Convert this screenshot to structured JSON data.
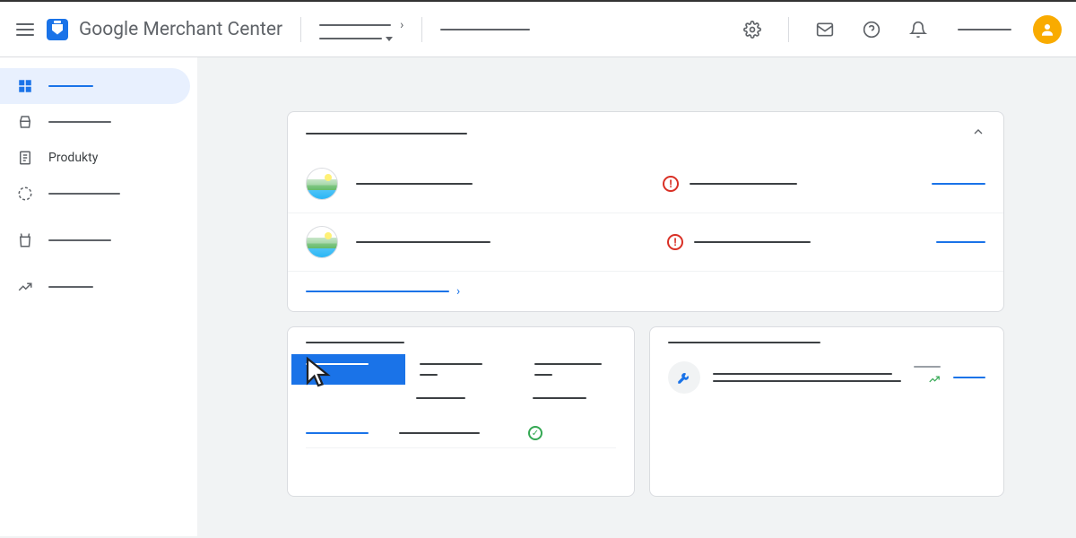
{
  "header": {
    "app_title": "Google Merchant Center",
    "account_selector": "",
    "search": "",
    "user_label": ""
  },
  "sidebar": {
    "items": [
      {
        "label": "",
        "icon": "dashboard",
        "active": true
      },
      {
        "label": "",
        "icon": "basket"
      },
      {
        "label": "Produkty",
        "icon": "document"
      },
      {
        "label": "",
        "icon": "circle-dashed"
      },
      {
        "label": "",
        "icon": "bag"
      },
      {
        "label": "",
        "icon": "trending"
      }
    ]
  },
  "main_card": {
    "title": "",
    "rows": [
      {
        "name": "",
        "status": "",
        "action": ""
      },
      {
        "name": "",
        "status": "",
        "action": ""
      }
    ],
    "footer_link": ""
  },
  "left_card": {
    "title": "",
    "tiles": [
      {
        "label": "",
        "value": ""
      },
      {
        "label": "",
        "value": ""
      },
      {
        "label": "",
        "value": ""
      }
    ],
    "rows": [
      {
        "col1": "",
        "col2": "",
        "status": "ok"
      }
    ]
  },
  "right_card": {
    "title": "",
    "insight": {
      "line1": "",
      "line2": "",
      "meta": "",
      "action": ""
    }
  },
  "colors": {
    "primary": "#1a73e8",
    "error": "#d93025",
    "success": "#34a853",
    "avatar": "#f9ab00"
  }
}
